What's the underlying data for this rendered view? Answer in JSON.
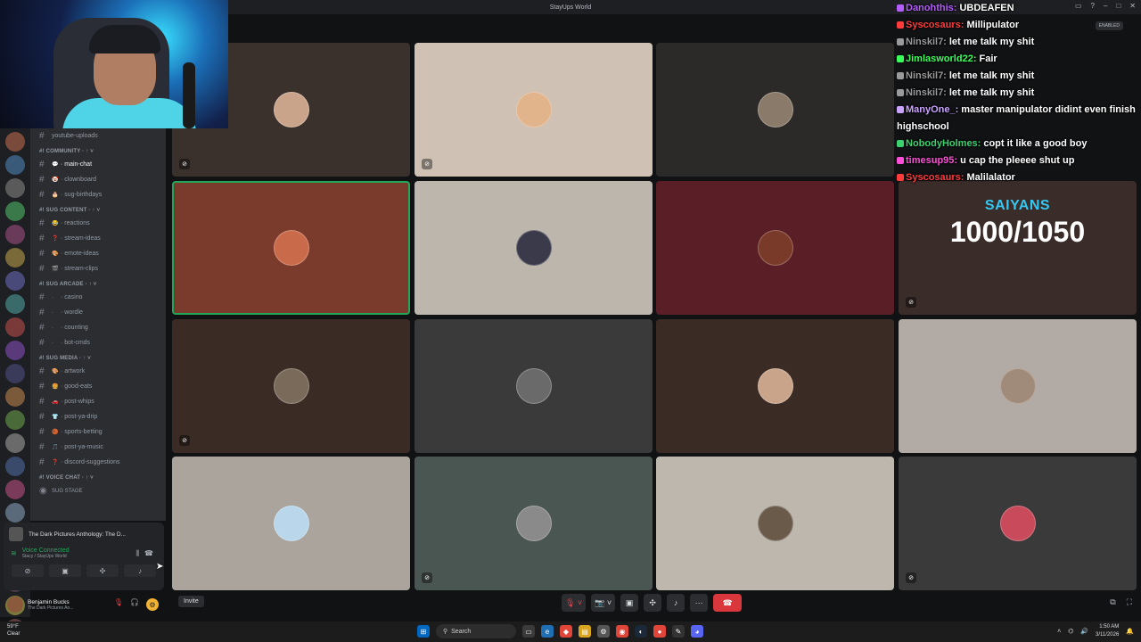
{
  "window": {
    "title": "StayUps World"
  },
  "channels": {
    "partial_top": "youtube-uploads",
    "categories": [
      {
        "name": "COMMUNITY",
        "items": [
          {
            "emoji": "💬",
            "label": "main-chat",
            "active": true
          },
          {
            "emoji": "🤡",
            "label": "clownboard"
          },
          {
            "emoji": "🎂",
            "label": "sug-birthdays"
          }
        ]
      },
      {
        "name": "SUG CONTENT",
        "items": [
          {
            "emoji": "😂",
            "label": "reactions"
          },
          {
            "emoji": "❓",
            "label": "stream-ideas"
          },
          {
            "emoji": "🎨",
            "label": "emote-ideas"
          },
          {
            "emoji": "🎬",
            "label": "stream-clips"
          }
        ]
      },
      {
        "name": "SUG ARCADE",
        "items": [
          {
            "emoji": "·",
            "label": "casino"
          },
          {
            "emoji": "·",
            "label": "wordle"
          },
          {
            "emoji": "·",
            "label": "counting"
          },
          {
            "emoji": "·",
            "label": "bot-cmds"
          }
        ]
      },
      {
        "name": "SUG MEDIA",
        "items": [
          {
            "emoji": "🎨",
            "label": "artwork"
          },
          {
            "emoji": "🍔",
            "label": "good-eats"
          },
          {
            "emoji": "🚗",
            "label": "post-whips"
          },
          {
            "emoji": "👕",
            "label": "post-ya-drip"
          },
          {
            "emoji": "🏀",
            "label": "sports-betting"
          },
          {
            "emoji": "🎵",
            "label": "post-ya-music"
          },
          {
            "emoji": "❓",
            "label": "discord-suggestions"
          }
        ]
      },
      {
        "name": "VOICE CHAT",
        "items": []
      }
    ],
    "stage_label": "SUG STAGE"
  },
  "rail": {
    "badges": [
      "",
      "",
      "",
      "",
      "",
      "",
      "",
      "",
      "",
      "",
      "",
      "",
      "",
      "",
      "",
      "",
      "",
      "",
      "",
      "",
      "",
      "",
      "NEW"
    ]
  },
  "voice_panel": {
    "activity": "The Dark Pictures Anthology: The D...",
    "status": "Voice Connected",
    "sub": "Stacy / StayUps World"
  },
  "user": {
    "name": "Benjamin Bucks",
    "status": "The Dark Pictures An..."
  },
  "overlay": {
    "title": "SAIYANS",
    "count": "1000/1050"
  },
  "chat": {
    "enabled_label": "ENABLED",
    "messages": [
      {
        "user": "Danohthis",
        "color": "#b55cff",
        "text": "UBDEAFEN"
      },
      {
        "user": "Syscosaurs",
        "color": "#ff3b3b",
        "text": "Millipulator"
      },
      {
        "user": "Ninskil7",
        "color": "#9a9a9a",
        "text": "let me talk my shit"
      },
      {
        "user": "Jimlasworld22",
        "color": "#39ff5a",
        "text": "Fair"
      },
      {
        "user": "Ninskil7",
        "color": "#9a9a9a",
        "text": "let me talk my shit"
      },
      {
        "user": "Ninskil7",
        "color": "#9a9a9a",
        "text": "let me talk my shit"
      },
      {
        "user": "ManyOne_",
        "color": "#c9a3ff",
        "text": "master manipulator didint even finish highschool"
      },
      {
        "user": "NobodyHolmes",
        "color": "#3bd16f",
        "text": "copt it like a good boy"
      },
      {
        "user": "timesup95",
        "color": "#ff4fd8",
        "text": "u cap the pleeee shut up"
      },
      {
        "user": "Syscosaurs",
        "color": "#ff3b3b",
        "text": "Malilalator"
      }
    ]
  },
  "tiles": [
    {
      "bg": "#3a302c",
      "avatar": "#c9a48a",
      "mute": true
    },
    {
      "bg": "#cfc2b4",
      "avatar": "#e2b48c",
      "mute": true
    },
    {
      "bg": "#2c2a28",
      "avatar": "#8a7a6a",
      "mute": false
    },
    {
      "bg": "#7a3a2c",
      "avatar": "#c96a4a",
      "mute": false,
      "active": true
    },
    {
      "bg": "#bdb6ad",
      "avatar": "#3a3a4a",
      "mute": false
    },
    {
      "bg": "#5a1e26",
      "avatar": "#7a3a2a",
      "mute": false
    },
    {
      "bg": "#3a2c24",
      "avatar": "#7a6a5a",
      "mute": true
    },
    {
      "bg": "#3a3a3a",
      "avatar": "#6a6a6a",
      "mute": false
    },
    {
      "bg": "#3a2c24",
      "avatar": "#c9a48a",
      "mute": false
    },
    {
      "bg": "#b2aaa4",
      "avatar": "#a08a7a",
      "mute": false
    },
    {
      "bg": "#aaa49d",
      "avatar": "#b9d6ea",
      "mute": false
    },
    {
      "bg": "#4a5651",
      "avatar": "#8a8a8a",
      "mute": true
    },
    {
      "bg": "#bdb7ae",
      "avatar": "#6a5a4a",
      "mute": false
    },
    {
      "bg": "#3a3a3a",
      "avatar": "#c94a5a",
      "mute": true
    },
    {
      "bg": "#b8a596",
      "avatar": "#c99a6a",
      "mute": false
    }
  ],
  "call": {
    "invite_label": "Invite"
  },
  "taskbar": {
    "weather_temp": "59°F",
    "weather_cond": "Clear",
    "search_label": "Search",
    "time": "1:50 AM",
    "date": "3/11/2026"
  }
}
